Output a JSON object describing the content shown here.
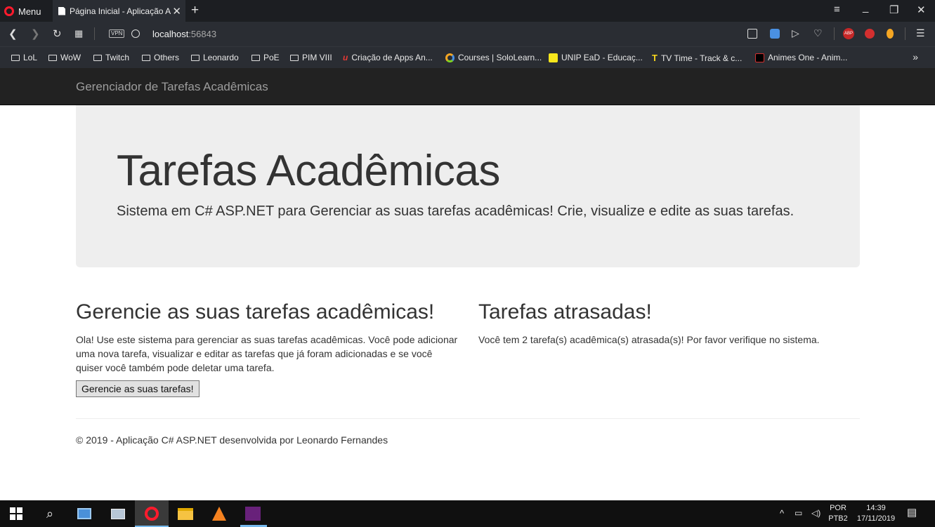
{
  "browser": {
    "menu_label": "Menu",
    "tab_title": "Página Inicial - Aplicação A",
    "url_host": "localhost",
    "url_port": ":56843",
    "vpn_label": "VPN",
    "abp_label": "ABP",
    "bookmarks": [
      {
        "label": "LoL",
        "icon": "folder"
      },
      {
        "label": "WoW",
        "icon": "folder"
      },
      {
        "label": "Twitch",
        "icon": "folder"
      },
      {
        "label": "Others",
        "icon": "folder"
      },
      {
        "label": "Leonardo",
        "icon": "folder"
      },
      {
        "label": "PoE",
        "icon": "folder"
      },
      {
        "label": "PIM VIII",
        "icon": "folder"
      },
      {
        "label": "Criação de Apps An...",
        "icon": "site"
      },
      {
        "label": "Courses | SoloLearn...",
        "icon": "site"
      },
      {
        "label": "UNIP EaD - Educaç...",
        "icon": "site"
      },
      {
        "label": "TV Time - Track & c...",
        "icon": "site"
      },
      {
        "label": "Animes One - Anim...",
        "icon": "site"
      }
    ]
  },
  "site": {
    "brand": "Gerenciador de Tarefas Acadêmicas",
    "jumbotron": {
      "title": "Tarefas Acadêmicas",
      "lead": "Sistema em C# ASP.NET para Gerenciar as suas tarefas acadêmicas! Crie, visualize e edite as suas tarefas."
    },
    "manage": {
      "heading": "Gerencie as suas tarefas acadêmicas!",
      "text": "Ola! Use este sistema para gerenciar as suas tarefas acadêmicas. Você pode adicionar uma nova tarefa, visualizar e editar as tarefas que já foram adicionadas e se você quiser você também pode deletar uma tarefa.",
      "button": "Gerencie as suas tarefas!"
    },
    "late": {
      "heading": "Tarefas atrasadas!",
      "text": "Você tem 2 tarefa(s) acadêmica(s) atrasada(s)! Por favor verifique no sistema."
    },
    "footer": "© 2019 - Aplicação C# ASP.NET desenvolvida por Leonardo Fernandes"
  },
  "taskbar": {
    "lang_top": "POR",
    "lang_bottom": "PTB2",
    "time": "14:39",
    "date": "17/11/2019"
  }
}
